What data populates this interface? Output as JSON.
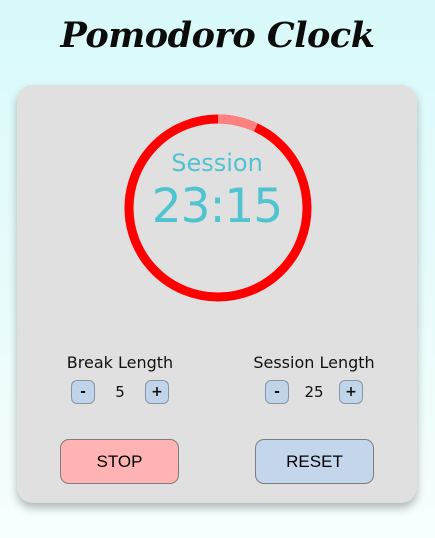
{
  "app": {
    "title": "Pomodoro Clock"
  },
  "timer": {
    "label": "Session",
    "time": "23:15",
    "elapsed_fraction": 0.07,
    "ring_color": "#ff0000",
    "elapsed_color": "#ff8080",
    "text_color": "#4fc3cf"
  },
  "break_control": {
    "label": "Break Length",
    "value": "5",
    "decrement": "-",
    "increment": "+"
  },
  "session_control": {
    "label": "Session Length",
    "value": "25",
    "decrement": "-",
    "increment": "+"
  },
  "buttons": {
    "stop": "STOP",
    "reset": "RESET",
    "stop_color": "#ffb3b3",
    "reset_color": "#c3d6ec"
  }
}
